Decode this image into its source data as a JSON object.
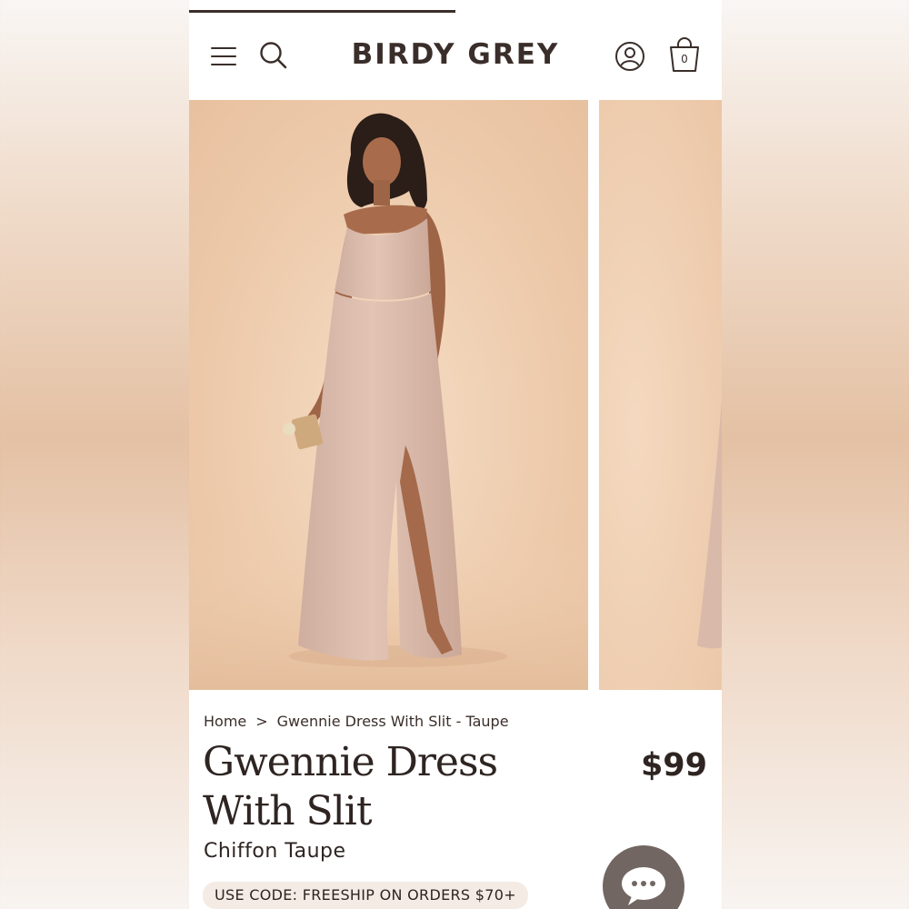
{
  "header": {
    "brand": "BIRDY GREY",
    "cart_count": "0",
    "icons": [
      "menu-icon",
      "search-icon",
      "account-icon",
      "shopping-bag-icon"
    ]
  },
  "gallery": {
    "slides": [
      "product-photo-1",
      "product-photo-2"
    ]
  },
  "breadcrumb": {
    "home": "Home",
    "separator": ">",
    "current": "Gwennie Dress With Slit - Taupe"
  },
  "product": {
    "title": "Gwennie Dress With Slit",
    "price": "$99",
    "subtitle": "Chiffon Taupe",
    "promo": "USE CODE: FREESHIP ON ORDERS $70+"
  },
  "chat": {
    "icon": "chat-bubble-icon"
  },
  "colors": {
    "text": "#2e2522",
    "backdrop": "#edcaab",
    "dress": "#dcbcae",
    "promo_bg": "#f4ebe4",
    "chat_bg": "#716661"
  }
}
